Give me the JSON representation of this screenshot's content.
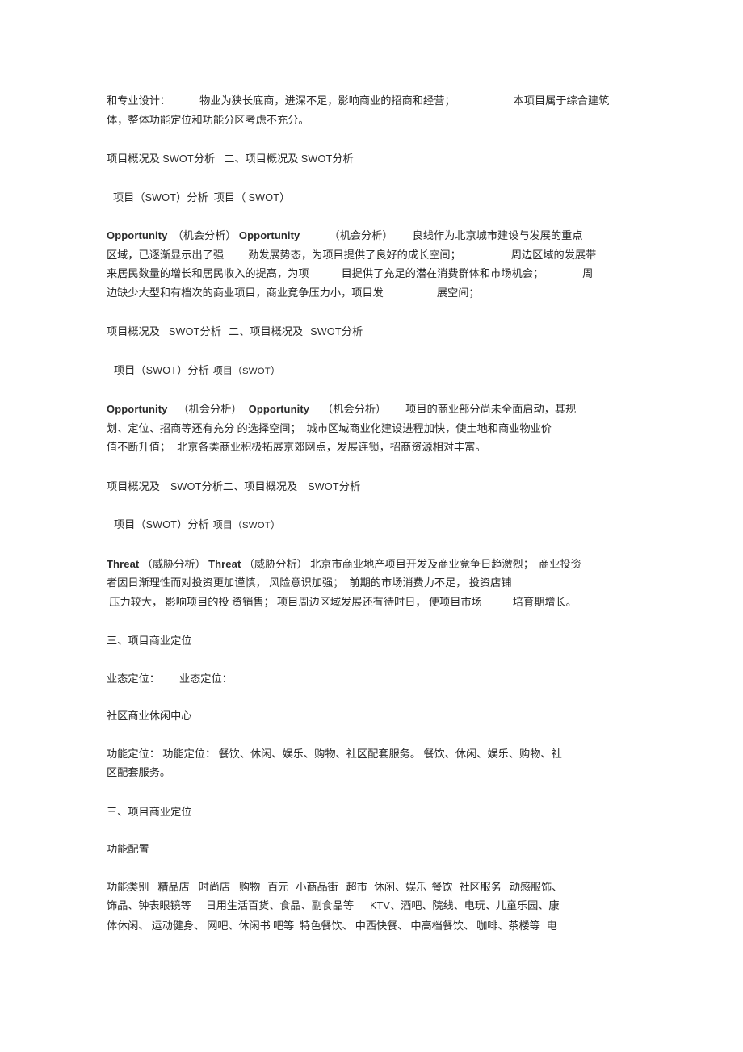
{
  "document": {
    "title": "项目概况及 SWOT 分析",
    "page_background": "#ffffff",
    "text_color": "#2b2b2b",
    "language": "zh-CN"
  },
  "blocks": {
    "intro": {
      "line1_a": "和专业设计：",
      "line1_b": "物业为狭长底商，进深不足，影响商业的招商和经营；",
      "line1_c": "本项目属于综合建筑",
      "line2": "体，整体功能定位和功能分区考虑不充分。"
    },
    "heading_1": {
      "part_a": "项目概况及",
      "swot": "SWOT",
      "part_b": "分析",
      "part_c": "二、项目概况及",
      "swot2": "SWOT",
      "part_d": "分析"
    },
    "subheading_1": {
      "part_a": "项目（",
      "swot": "SWOT",
      "part_b": "）分析",
      "part_c": "项目（",
      "swot2": "SWOT",
      "part_d": "）"
    },
    "opportunity_1": {
      "keyword": "Opportunity",
      "label": "（机会分析）",
      "keyword2": "Opportunity",
      "label2": "（机会分析）",
      "line1_tail": "良线作为北京城市建设与发展的重点",
      "line2_a": "区域，已逐渐显示出了强",
      "line2_b": "劲发展势态，为项目提供了良好的成长空间；",
      "line2_c": "周边区域的发展带",
      "line3_a": "来居民数量的增长和居民收入的提高，为项",
      "line3_b": "目提供了充足的潜在消费群体和市场机会；",
      "line3_c": "周",
      "line4_a": "边缺少大型和有档次的商业项目，商业竞争压力小，项目发",
      "line4_b": "展空间；"
    },
    "heading_2": {
      "part_a": "项目概况及",
      "swot": "SWOT",
      "part_b": "分析",
      "part_c": "二、项目概况及",
      "swot2": "SWOT",
      "part_d": "分析"
    },
    "subheading_2": {
      "part_a": "项目（",
      "swot": "SWOT",
      "part_b": "）分析",
      "part_c": "项目（",
      "swot2": "SWOT",
      "part_d": "）"
    },
    "opportunity_2": {
      "keyword": "Opportunity",
      "label": "（机会分析）",
      "keyword2": "Opportunity",
      "label2": "（机会分析）",
      "line1_tail": "项目的商业部分尚未全面启动，其规",
      "line2_a": "划、定位、招商等还有充分",
      "line2_b": "的选择空间；",
      "line2_c": "城市区域商业化建设进程加快，使土地和商业物业价",
      "line3_a": "值不断升值；",
      "line3_b": "北京各类商业积极拓展京郊网点，发展连锁，招商资源相对丰富。"
    },
    "heading_3": {
      "part_a": "项目概况及",
      "swot": "SWOT",
      "part_b": "分析二、项目概况及",
      "swot2": "SWOT",
      "part_d": "分析"
    },
    "subheading_3": {
      "part_a": "项目（",
      "swot": "SWOT",
      "part_b": "）分析",
      "part_c": "项目（",
      "swot2": "SWOT",
      "part_d": "）"
    },
    "threat": {
      "keyword": "Threat",
      "label": "（威胁分析）",
      "keyword2": "Threat",
      "label2": "（威胁分析）",
      "line1_tail": "北京市商业地产项目开发及商业竞争日趋激烈；",
      "line1_end": "商业投资",
      "line2_a": "者因日渐理性而对投资更加谨慎，",
      "line2_b": "风险意识加强；",
      "line2_c": "前期的市场消费力不足，",
      "line2_d": "投资店铺",
      "line3_a": "压力较大，",
      "line3_b": "影响项目的投",
      "line3_c": "资销售；",
      "line3_d": "项目周边区域发展还有待时日，",
      "line3_e": "使项目市场",
      "line3_f": "培育期增长。"
    },
    "section_3_heading_a": "三、项目商业定位",
    "format_positioning": {
      "label_a": "业态定位：",
      "label_b": "业态定位："
    },
    "format_value": "社区商业休闲中心",
    "function_positioning": {
      "label_a": "功能定位：",
      "label_b": "功能定位：",
      "value_a": "餐饮、休闲、娱乐、购物、社区配套服务。",
      "value_b": "餐饮、休闲、娱乐、购物、社",
      "value_c": "区配套服务。"
    },
    "section_3_heading_b": "三、项目商业定位",
    "function_config_heading": "功能配置",
    "function_table": {
      "row1_col1": "功能类别",
      "row1_col2": "精品店",
      "row1_col3": "时尚店",
      "row1_col4": "购物",
      "row1_col5": "百元",
      "row1_col6": "小商品街",
      "row1_col7": "超市",
      "row1_col8": "休闲、娱乐",
      "row1_col9": "餐饮",
      "row1_col10": "社区服务",
      "row1_col11": "动感服饰、",
      "row2_col1": "饰品、钟表眼镜等",
      "row2_col2": "日用生活百货、食品、副食品等",
      "row2_col3_lat": "KTV",
      "row2_col3": "、酒吧、院线、电玩、儿童乐园、康",
      "row3_col1": "体休闲、",
      "row3_col2": "运动健身、",
      "row3_col3": "网吧、休闲书",
      "row3_col4": "吧等",
      "row3_col5": "特色餐饮、",
      "row3_col6": "中西快餐、",
      "row3_col7": "中高档餐饮、",
      "row3_col8": "咖啡、茶楼等",
      "row3_col9": "电"
    }
  }
}
